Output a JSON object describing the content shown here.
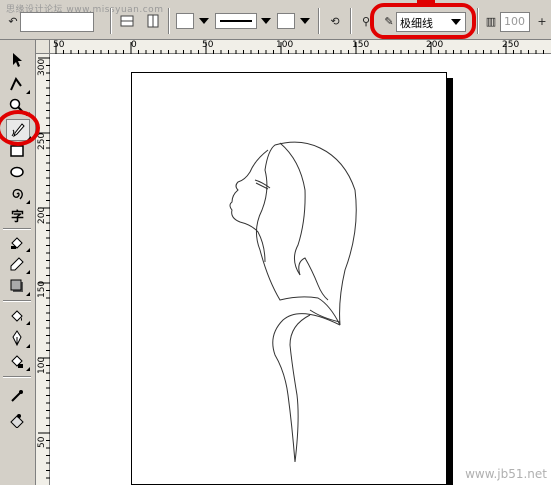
{
  "watermark_text": "思缘设计论坛 www.missyuan.com",
  "propbar": {
    "outline_width_value": "极细线",
    "scale_value": "100",
    "icons": {
      "start_arrow": "arrow-start-icon",
      "end_arrow": "arrow-end-icon",
      "line_style": "line-style-icon",
      "pen": "pen-nib-icon",
      "wrap": "wrap-text-icon"
    }
  },
  "hruler": {
    "labels": [
      "50",
      "0",
      "50",
      "100",
      "150",
      "200",
      "250"
    ]
  },
  "vruler": {
    "labels": [
      "300",
      "250",
      "200",
      "150",
      "100",
      "50"
    ]
  },
  "toolbox": {
    "tools": [
      "pick-tool-icon",
      "shape-tool-icon",
      "zoom-tool-icon",
      "freehand-tool-icon",
      "rectangle-tool-icon",
      "ellipse-tool-icon",
      "spiral-tool-icon",
      "text-tool-icon",
      "interactive-fill-icon",
      "eyedropper-icon",
      "shadow-tool-icon",
      "fill-tool-icon",
      "outline-pen-icon",
      "paint-bucket-icon",
      "color-picker-icon",
      "eraser-tool-icon"
    ]
  },
  "site_watermark": "www.jb51.net",
  "colors": {
    "annotation": "#e00000",
    "ui_gray": "#d4d0c8"
  }
}
